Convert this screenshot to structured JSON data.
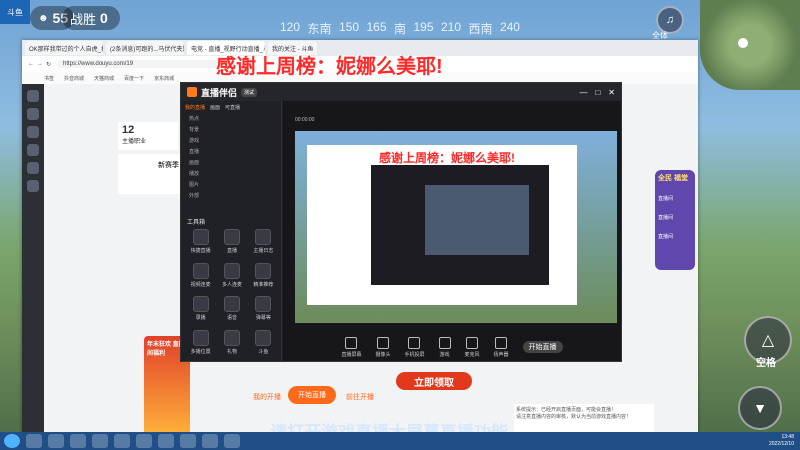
{
  "hud": {
    "players": "55",
    "kills_label": "战胜",
    "kills": "0",
    "compass": [
      "120",
      "东南",
      "150",
      "165",
      "南",
      "195",
      "210",
      "西南",
      "240"
    ],
    "fullscreen_label": "全体",
    "jump_label": "空格"
  },
  "browser": {
    "tabs": [
      "OK那样我带过的个人自虎_抖音搜...",
      "(2条消息)可跑的...马伏代夹是4天",
      "电竞 - 直播_视野行动直播_斗鱼直播",
      "我的关注 - 斗鱼"
    ],
    "url": "https://www.douyu.com/19",
    "bookmarks": [
      "书签",
      "抖音商城",
      "天猫商城",
      "百度一下",
      "京东商城"
    ],
    "page_count": "12",
    "page_label": "主播职业",
    "banner_text": "新赛季",
    "footer_buttons": [
      "我的开播",
      "开始直播",
      "前往开播"
    ],
    "promo_label": "立即领取",
    "event_title": "年末狂欢 直播间福利"
  },
  "obs": {
    "app_name": "直播伴侣",
    "app_badge": "测试",
    "tabs": [
      "我的直播",
      "画面",
      "可直播"
    ],
    "scene_items": [
      "热点",
      "背景",
      "游戏",
      "直播",
      "画面",
      "播放",
      "图片",
      "外部"
    ],
    "section_label": "工具箱",
    "tools": [
      "快捷直播",
      "直播",
      "主播日志",
      "视频连麦",
      "多人连麦",
      "精准推荐",
      "录播",
      "语音",
      "弹幕等",
      "多播位置",
      "礼物",
      "斗鱼"
    ],
    "bottom_tools": [
      "直播屏幕",
      "摄像头",
      "手机投屏",
      "游戏",
      "麦克风",
      "扬声器"
    ],
    "start_button": "开始直播",
    "timer": "00:00:00"
  },
  "overlay": {
    "title": "感谢上周榜：妮娜么美耶!"
  },
  "right_panel": {
    "badge": "全民 福堂",
    "items": [
      "直播间",
      "直播间",
      "直播间"
    ]
  },
  "chat": {
    "lines": [
      "系统提示：已经开启直播页面，可能会直播！",
      "请注意直播内容的审核，默认为当前游戏直播内容！"
    ]
  },
  "bottom_caption": "请打开游戏直播大屏幕直播功能",
  "taskbar": {
    "time": "13:48",
    "date": "2022/12/10"
  }
}
